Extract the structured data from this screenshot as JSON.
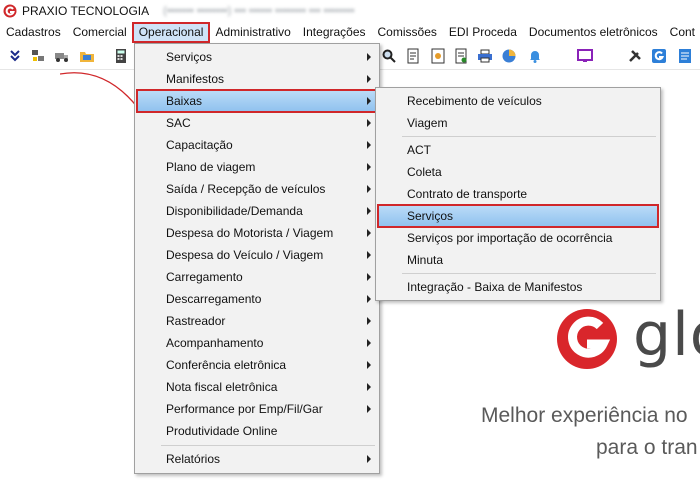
{
  "window": {
    "title": "PRAXIO TECNOLOGIA",
    "title_obscured": "(••••••• ••••••••) ••• •••••• •••••••• ••• ••••••••"
  },
  "menubar": {
    "items": [
      "Cadastros",
      "Comercial",
      "Operacional",
      "Administrativo",
      "Integrações",
      "Comissões",
      "EDI Proceda",
      "Documentos eletrônicos",
      "Cont"
    ],
    "active_index": 2
  },
  "menu_operacional": {
    "items": [
      {
        "label": "Serviços",
        "submenu": true
      },
      {
        "label": "Manifestos",
        "submenu": true
      },
      {
        "label": "Baixas",
        "submenu": true
      },
      {
        "label": "SAC",
        "submenu": true
      },
      {
        "label": "Capacitação",
        "submenu": true
      },
      {
        "label": "Plano de viagem",
        "submenu": true
      },
      {
        "label": "Saída / Recepção de veículos",
        "submenu": true
      },
      {
        "label": "Disponibilidade/Demanda",
        "submenu": true
      },
      {
        "label": "Despesa do Motorista / Viagem",
        "submenu": true
      },
      {
        "label": "Despesa do Veículo / Viagem",
        "submenu": true
      },
      {
        "label": "Carregamento",
        "submenu": true
      },
      {
        "label": "Descarregamento",
        "submenu": true
      },
      {
        "label": "Rastreador",
        "submenu": true
      },
      {
        "label": "Acompanhamento",
        "submenu": true
      },
      {
        "label": "Conferência eletrônica",
        "submenu": true
      },
      {
        "label": "Nota fiscal eletrônica",
        "submenu": true
      },
      {
        "label": "Performance por Emp/Fil/Gar",
        "submenu": true
      },
      {
        "label": "Produtividade Online",
        "submenu": false
      },
      {
        "label": "Relatórios",
        "submenu": true
      }
    ],
    "highlighted_index": 2
  },
  "menu_baixas": {
    "items": [
      {
        "label": "Recebimento de veículos"
      },
      {
        "label": "Viagem"
      },
      {
        "label": "ACT"
      },
      {
        "label": "Coleta"
      },
      {
        "label": "Contrato de transporte"
      },
      {
        "label": "Serviços"
      },
      {
        "label": "Serviços por importação de ocorrência"
      },
      {
        "label": "Minuta"
      },
      {
        "label": "Integração - Baixa de Manifestos"
      }
    ],
    "highlighted_index": 5
  },
  "brand": {
    "word": "glo",
    "tagline_line1": "Melhor experiência no",
    "tagline_line2": "para o tran"
  },
  "colors": {
    "accent_red": "#d0272a",
    "highlight_blue": "#9ccbf2",
    "menu_bg": "#f2f2f2"
  },
  "toolbar_icons": [
    "arrow-down-icon",
    "network-icon",
    "truck-icon",
    "folder-icon",
    "calculator-icon",
    "search-icon",
    "report-icon",
    "chart-icon",
    "printer-icon",
    "pie-chart-icon",
    "bell-icon",
    "monitor-icon",
    "tools-icon",
    "brand-g-icon",
    "document-icon"
  ]
}
